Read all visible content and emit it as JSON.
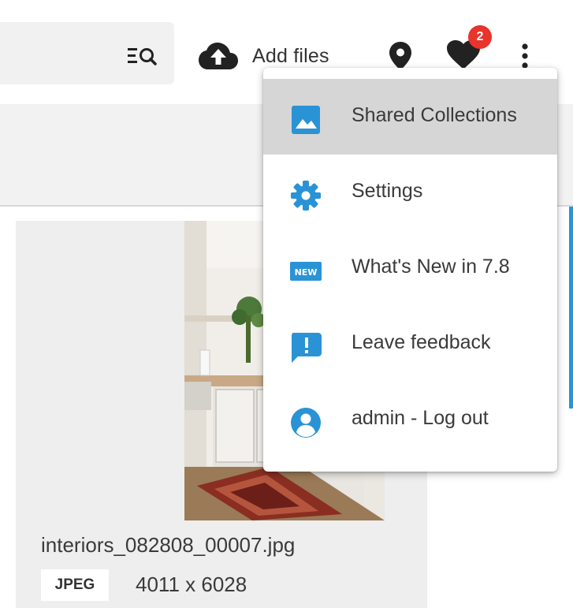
{
  "colors": {
    "accent": "#2a93d5",
    "badge": "#e8342b",
    "icon_dark": "#222222",
    "menu_active": "#d6d6d6"
  },
  "toolbar": {
    "add_files_label": "Add files",
    "favorites_count": "2"
  },
  "menu": {
    "items": [
      {
        "label": "Shared Collections",
        "icon": "image-icon",
        "active": true
      },
      {
        "label": "Settings",
        "icon": "gear-icon",
        "active": false
      },
      {
        "label": "What's New in 7.8",
        "icon": "new-badge-icon",
        "icon_text": "NEW",
        "active": false
      },
      {
        "label": "Leave feedback",
        "icon": "feedback-icon",
        "active": false
      },
      {
        "label": "admin - Log out",
        "icon": "account-icon",
        "active": false
      }
    ]
  },
  "file": {
    "name": "interiors_082808_00007.jpg",
    "type": "JPEG",
    "dimensions": "4011 x 6028"
  }
}
